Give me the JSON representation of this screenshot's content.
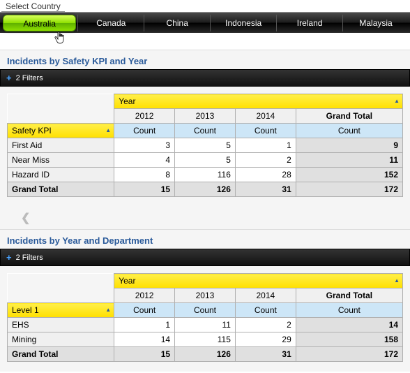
{
  "selectCountryLabel": "Select Country",
  "tabs": [
    {
      "label": "Australia",
      "active": true
    },
    {
      "label": "Canada",
      "active": false
    },
    {
      "label": "China",
      "active": false
    },
    {
      "label": "Indonesia",
      "active": false
    },
    {
      "label": "Ireland",
      "active": false
    },
    {
      "label": "Malaysia",
      "active": false
    }
  ],
  "filterText": "2 Filters",
  "yearHeader": "Year",
  "countLabel": "Count",
  "grandTotalLabel": "Grand Total",
  "panel1": {
    "title": "Incidents by Safety KPI and Year",
    "rowDimLabel": "Safety KPI",
    "years": [
      "2012",
      "2013",
      "2014"
    ],
    "rows": [
      {
        "label": "First Aid",
        "vals": [
          "3",
          "5",
          "1"
        ],
        "total": "9"
      },
      {
        "label": "Near Miss",
        "vals": [
          "4",
          "5",
          "2"
        ],
        "total": "11"
      },
      {
        "label": "Hazard ID",
        "vals": [
          "8",
          "116",
          "28"
        ],
        "total": "152"
      }
    ],
    "totals": {
      "vals": [
        "15",
        "126",
        "31"
      ],
      "total": "172"
    }
  },
  "panel2": {
    "title": "Incidents by Year and Department",
    "rowDimLabel": "Level 1",
    "years": [
      "2012",
      "2013",
      "2014"
    ],
    "rows": [
      {
        "label": "EHS",
        "vals": [
          "1",
          "11",
          "2"
        ],
        "total": "14"
      },
      {
        "label": "Mining",
        "vals": [
          "14",
          "115",
          "29"
        ],
        "total": "158"
      }
    ],
    "totals": {
      "vals": [
        "15",
        "126",
        "31"
      ],
      "total": "172"
    }
  },
  "chart_data": [
    {
      "type": "table",
      "title": "Incidents by Safety KPI and Year",
      "categories": [
        "2012",
        "2013",
        "2014"
      ],
      "series": [
        {
          "name": "First Aid",
          "values": [
            3,
            5,
            1
          ]
        },
        {
          "name": "Near Miss",
          "values": [
            4,
            5,
            2
          ]
        },
        {
          "name": "Hazard ID",
          "values": [
            8,
            116,
            28
          ]
        }
      ],
      "column_totals": [
        15,
        126,
        31
      ],
      "row_totals": [
        9,
        11,
        152
      ],
      "grand_total": 172
    },
    {
      "type": "table",
      "title": "Incidents by Year and Department",
      "categories": [
        "2012",
        "2013",
        "2014"
      ],
      "series": [
        {
          "name": "EHS",
          "values": [
            1,
            11,
            2
          ]
        },
        {
          "name": "Mining",
          "values": [
            14,
            115,
            29
          ]
        }
      ],
      "column_totals": [
        15,
        126,
        31
      ],
      "row_totals": [
        14,
        158
      ],
      "grand_total": 172
    }
  ]
}
